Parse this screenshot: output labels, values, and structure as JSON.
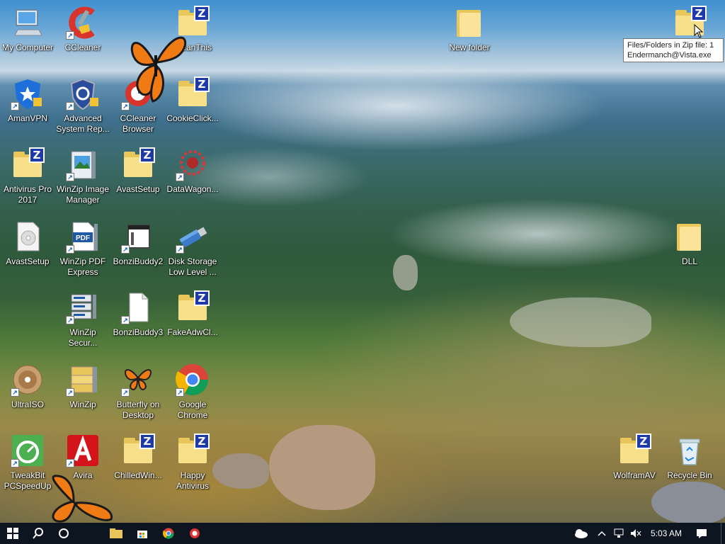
{
  "desktop_icons": [
    {
      "id": "my-computer",
      "label": "My Computer",
      "icon": "computer-icon",
      "shortcut": false
    },
    {
      "id": "ccleaner",
      "label": "CCleaner",
      "icon": "ccleaner-icon",
      "shortcut": true
    },
    {
      "id": "cleanthis",
      "label": "CleanThis",
      "icon": "zip-folder-icon",
      "shortcut": false
    },
    {
      "id": "new-folder",
      "label": "New folder",
      "icon": "folder-icon",
      "shortcut": false
    },
    {
      "id": "zip-top-right",
      "label": "",
      "icon": "zip-folder-icon",
      "shortcut": false
    },
    {
      "id": "amanvpn",
      "label": "AmanVPN",
      "icon": "vpn-shield-icon",
      "shortcut": true
    },
    {
      "id": "advanced-system-repair",
      "label": "Advanced\nSystem Rep...",
      "icon": "system-repair-icon",
      "shortcut": true
    },
    {
      "id": "ccleaner-browser",
      "label": "CCleaner\nBrowser",
      "icon": "ccleaner-browser-icon",
      "shortcut": true
    },
    {
      "id": "cookieclick",
      "label": "CookieClick...",
      "icon": "zip-folder-icon",
      "shortcut": false
    },
    {
      "id": "antivirus-pro-2017",
      "label": "Antivirus Pro\n2017",
      "icon": "zip-folder-icon",
      "shortcut": false
    },
    {
      "id": "winzip-image-manager",
      "label": "WinZip Image\nManager",
      "icon": "winzip-image-icon",
      "shortcut": true
    },
    {
      "id": "avastsetup-zip",
      "label": "AvastSetup",
      "icon": "zip-folder-icon",
      "shortcut": false
    },
    {
      "id": "datawagon",
      "label": "DataWagon...",
      "icon": "datawagon-icon",
      "shortcut": true
    },
    {
      "id": "avastsetup",
      "label": "AvastSetup",
      "icon": "setup-disc-icon",
      "shortcut": false
    },
    {
      "id": "winzip-pdf-express",
      "label": "WinZip PDF\nExpress",
      "icon": "pdf-icon",
      "shortcut": true
    },
    {
      "id": "bonzibuddy2",
      "label": "BonziBuddy2",
      "icon": "app-window-icon",
      "shortcut": true
    },
    {
      "id": "disk-storage",
      "label": "Disk Storage\nLow Level ...",
      "icon": "usb-drive-icon",
      "shortcut": true
    },
    {
      "id": "dll",
      "label": "DLL",
      "icon": "folder-icon",
      "shortcut": false
    },
    {
      "id": "winzip-secure",
      "label": "WinZip\nSecur...",
      "icon": "server-icon",
      "shortcut": true
    },
    {
      "id": "bonzibuddy3",
      "label": "BonziBuddy3",
      "icon": "blank-file-icon",
      "shortcut": true
    },
    {
      "id": "fakeadwcl",
      "label": "FakeAdwCl...",
      "icon": "zip-folder-icon",
      "shortcut": false
    },
    {
      "id": "ultraiso",
      "label": "UltraISO",
      "icon": "disc-icon",
      "shortcut": true
    },
    {
      "id": "winzip",
      "label": "WinZip",
      "icon": "winzip-icon",
      "shortcut": true
    },
    {
      "id": "butterfly-on-desktop",
      "label": "Butterfly on\nDesktop",
      "icon": "butterfly-icon",
      "shortcut": true
    },
    {
      "id": "google-chrome",
      "label": "Google\nChrome",
      "icon": "chrome-icon",
      "shortcut": true
    },
    {
      "id": "tweakbit",
      "label": "TweakBit\nPCSpeedUp",
      "icon": "speedometer-icon",
      "shortcut": true
    },
    {
      "id": "avira",
      "label": "Avira",
      "icon": "avira-icon",
      "shortcut": true
    },
    {
      "id": "chilledwin",
      "label": "ChilledWin...",
      "icon": "zip-folder-icon",
      "shortcut": false
    },
    {
      "id": "happy-antivirus",
      "label": "Happy\nAntivirus",
      "icon": "zip-folder-icon",
      "shortcut": false
    },
    {
      "id": "wolframav",
      "label": "WolframAV",
      "icon": "zip-folder-icon",
      "shortcut": false
    },
    {
      "id": "recycle-bin",
      "label": "Recycle Bin",
      "icon": "recycle-bin-icon",
      "shortcut": false
    }
  ],
  "tooltip": {
    "line1": "Files/Folders in Zip file: 1",
    "line2": "Endermanch@Vista.exe"
  },
  "taskbar": {
    "clock": "5:03 AM",
    "pinned": [
      "windows-start-icon",
      "search-icon",
      "cortana-icon",
      "file-explorer-icon",
      "store-icon",
      "chrome-icon",
      "ccleaner-browser-icon"
    ],
    "tray": [
      "onedrive-cloud-icon",
      "chevron-up-icon",
      "network-icon",
      "volume-muted-icon"
    ]
  },
  "colors": {
    "taskbar": "#0d1620",
    "zip_badge": "#1e3aa8",
    "folder": "#f8e08a",
    "butterfly": "#f07a14"
  }
}
